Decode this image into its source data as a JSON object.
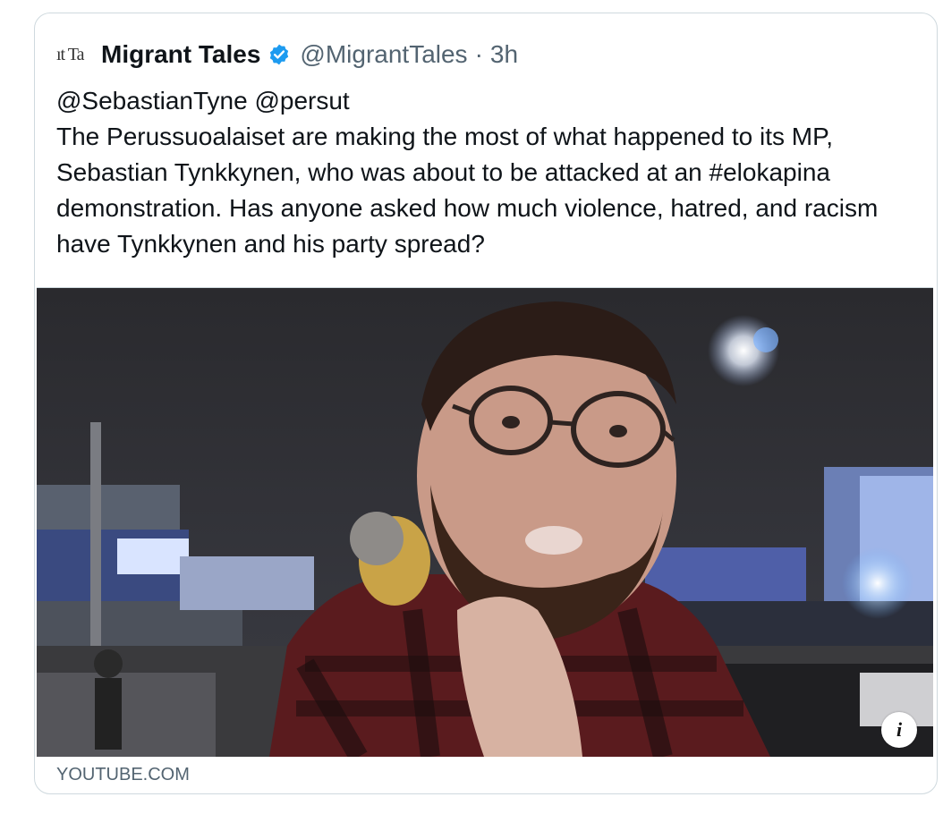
{
  "tweet": {
    "avatar_text": "ıt Ta",
    "display_name": "Migrant Tales",
    "handle": "@MigrantTales",
    "separator": "·",
    "time": "3h",
    "mentions": "@SebastianTyne @persut",
    "text": "The Perussuoalaiset are making the most of what happened to its MP, Sebastian Tynkkynen, who was about to be attacked at an #elokapina demonstration. Has anyone asked how much violence, hatred, and racism have Tynkkynen and his party spread?",
    "verified_icon": "verified-badge-icon",
    "verified_color": "#1d9bf0"
  },
  "card": {
    "domain": "YOUTUBE.COM",
    "info_icon_text": "i",
    "info_icon": "info-icon"
  }
}
